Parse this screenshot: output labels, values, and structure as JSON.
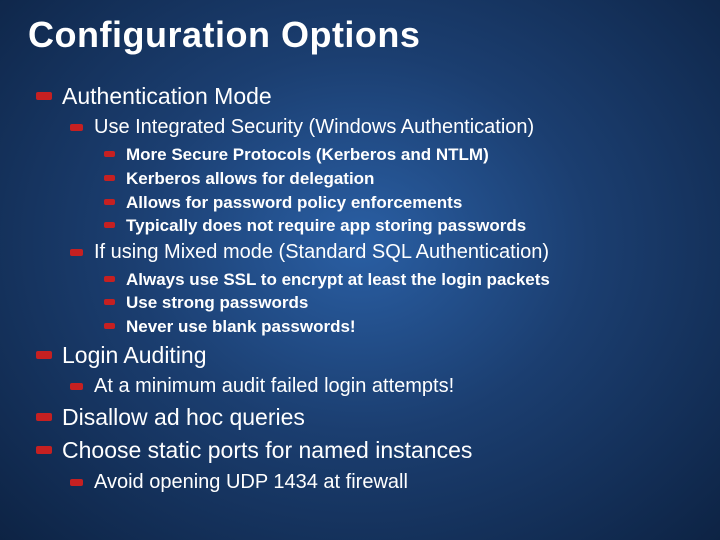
{
  "title": "Configuration Options",
  "b1": "Authentication Mode",
  "b1_1": "Use Integrated Security (Windows Authentication)",
  "b1_1_1": "More Secure Protocols (Kerberos and NTLM)",
  "b1_1_2": "Kerberos allows for delegation",
  "b1_1_3": "Allows for password policy enforcements",
  "b1_1_4": "Typically does not require app storing passwords",
  "b1_2": "If using Mixed mode (Standard SQL Authentication)",
  "b1_2_1": "Always use SSL to encrypt at least the login packets",
  "b1_2_2": "Use strong passwords",
  "b1_2_3": "Never use blank passwords!",
  "b2": "Login Auditing",
  "b2_1": "At a minimum audit failed login attempts!",
  "b3": "Disallow ad hoc queries",
  "b4": "Choose static ports for named instances",
  "b4_1": "Avoid opening UDP 1434 at firewall"
}
